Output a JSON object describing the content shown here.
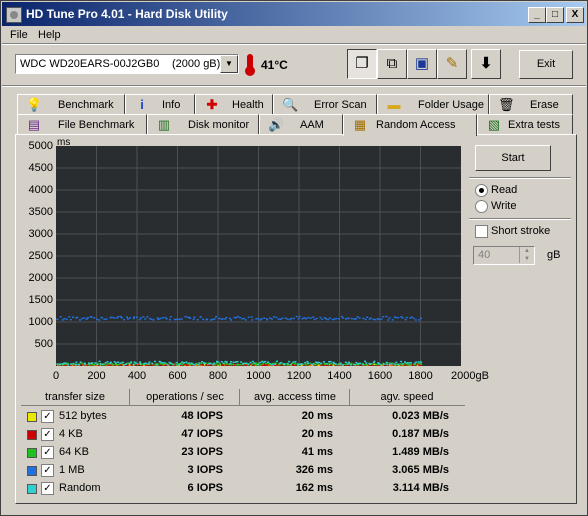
{
  "window": {
    "title": "HD Tune Pro 4.01 - Hard Disk Utility"
  },
  "controls": {
    "minimize": "_",
    "maximize": "□",
    "close": "X"
  },
  "menu": {
    "file": "File",
    "help": "Help"
  },
  "drive": {
    "name": "WDC WD20EARS-00J2GB0",
    "size": "(2000 gB)",
    "temperature": "41°C"
  },
  "toolbar": {
    "exit": "Exit"
  },
  "tabs_row1": [
    {
      "label": "Benchmark",
      "icon": "bulb-icon"
    },
    {
      "label": "Info",
      "icon": "info-icon"
    },
    {
      "label": "Health",
      "icon": "health-cross-icon"
    },
    {
      "label": "Error Scan",
      "icon": "magnifier-icon"
    },
    {
      "label": "Folder Usage",
      "icon": "folder-icon"
    },
    {
      "label": "Erase",
      "icon": "trash-icon"
    }
  ],
  "tabs_row2": [
    {
      "label": "File Benchmark",
      "icon": "file-benchmark-icon"
    },
    {
      "label": "Disk monitor",
      "icon": "disk-monitor-icon"
    },
    {
      "label": "AAM",
      "icon": "speaker-icon"
    },
    {
      "label": "Random Access",
      "icon": "random-access-icon",
      "active": true
    },
    {
      "label": "Extra tests",
      "icon": "extra-tests-icon"
    }
  ],
  "side": {
    "start": "Start",
    "read": "Read",
    "write": "Write",
    "mode": "Read",
    "short_stroke": "Short stroke",
    "short_stroke_checked": false,
    "stroke_value": "40",
    "stroke_unit": "gB"
  },
  "table": {
    "headers": [
      "transfer size",
      "operations / sec",
      "avg. access time",
      "agv. speed"
    ],
    "rows": [
      {
        "label": "512 bytes",
        "color": "#e8e800",
        "checked": true,
        "ops": "48 IOPS",
        "access": "20 ms",
        "speed": "0.023 MB/s"
      },
      {
        "label": "4 KB",
        "color": "#d00000",
        "checked": true,
        "ops": "47 IOPS",
        "access": "20 ms",
        "speed": "0.187 MB/s"
      },
      {
        "label": "64 KB",
        "color": "#20c020",
        "checked": true,
        "ops": "23 IOPS",
        "access": "41 ms",
        "speed": "1.489 MB/s"
      },
      {
        "label": "1 MB",
        "color": "#2070e0",
        "checked": true,
        "ops": "3 IOPS",
        "access": "326 ms",
        "speed": "3.065 MB/s"
      },
      {
        "label": "Random",
        "color": "#30d0d0",
        "checked": true,
        "ops": "6 IOPS",
        "access": "162 ms",
        "speed": "3.114 MB/s"
      }
    ]
  },
  "chart_data": {
    "type": "scatter",
    "y_unit": "ms",
    "ylim": [
      0,
      5000
    ],
    "xlim": [
      0,
      2000
    ],
    "y_ticks": [
      "5000",
      "4500",
      "4000",
      "3500",
      "3000",
      "2500",
      "2000",
      "1500",
      "1000",
      "500"
    ],
    "x_ticks": [
      "0",
      "200",
      "400",
      "600",
      "800",
      "1000",
      "1200",
      "1400",
      "1600",
      "1800",
      "2000gB"
    ],
    "grid": true,
    "series": [
      {
        "color": "#e8e800",
        "level": 20,
        "spread": 10
      },
      {
        "color": "#d00000",
        "level": 20,
        "spread": 10
      },
      {
        "color": "#20c020",
        "level": 41,
        "spread": 20
      },
      {
        "color": "#2070e0",
        "level": 1080,
        "spread": 40
      },
      {
        "color": "#30d0d0",
        "level": 60,
        "spread": 40
      }
    ]
  }
}
